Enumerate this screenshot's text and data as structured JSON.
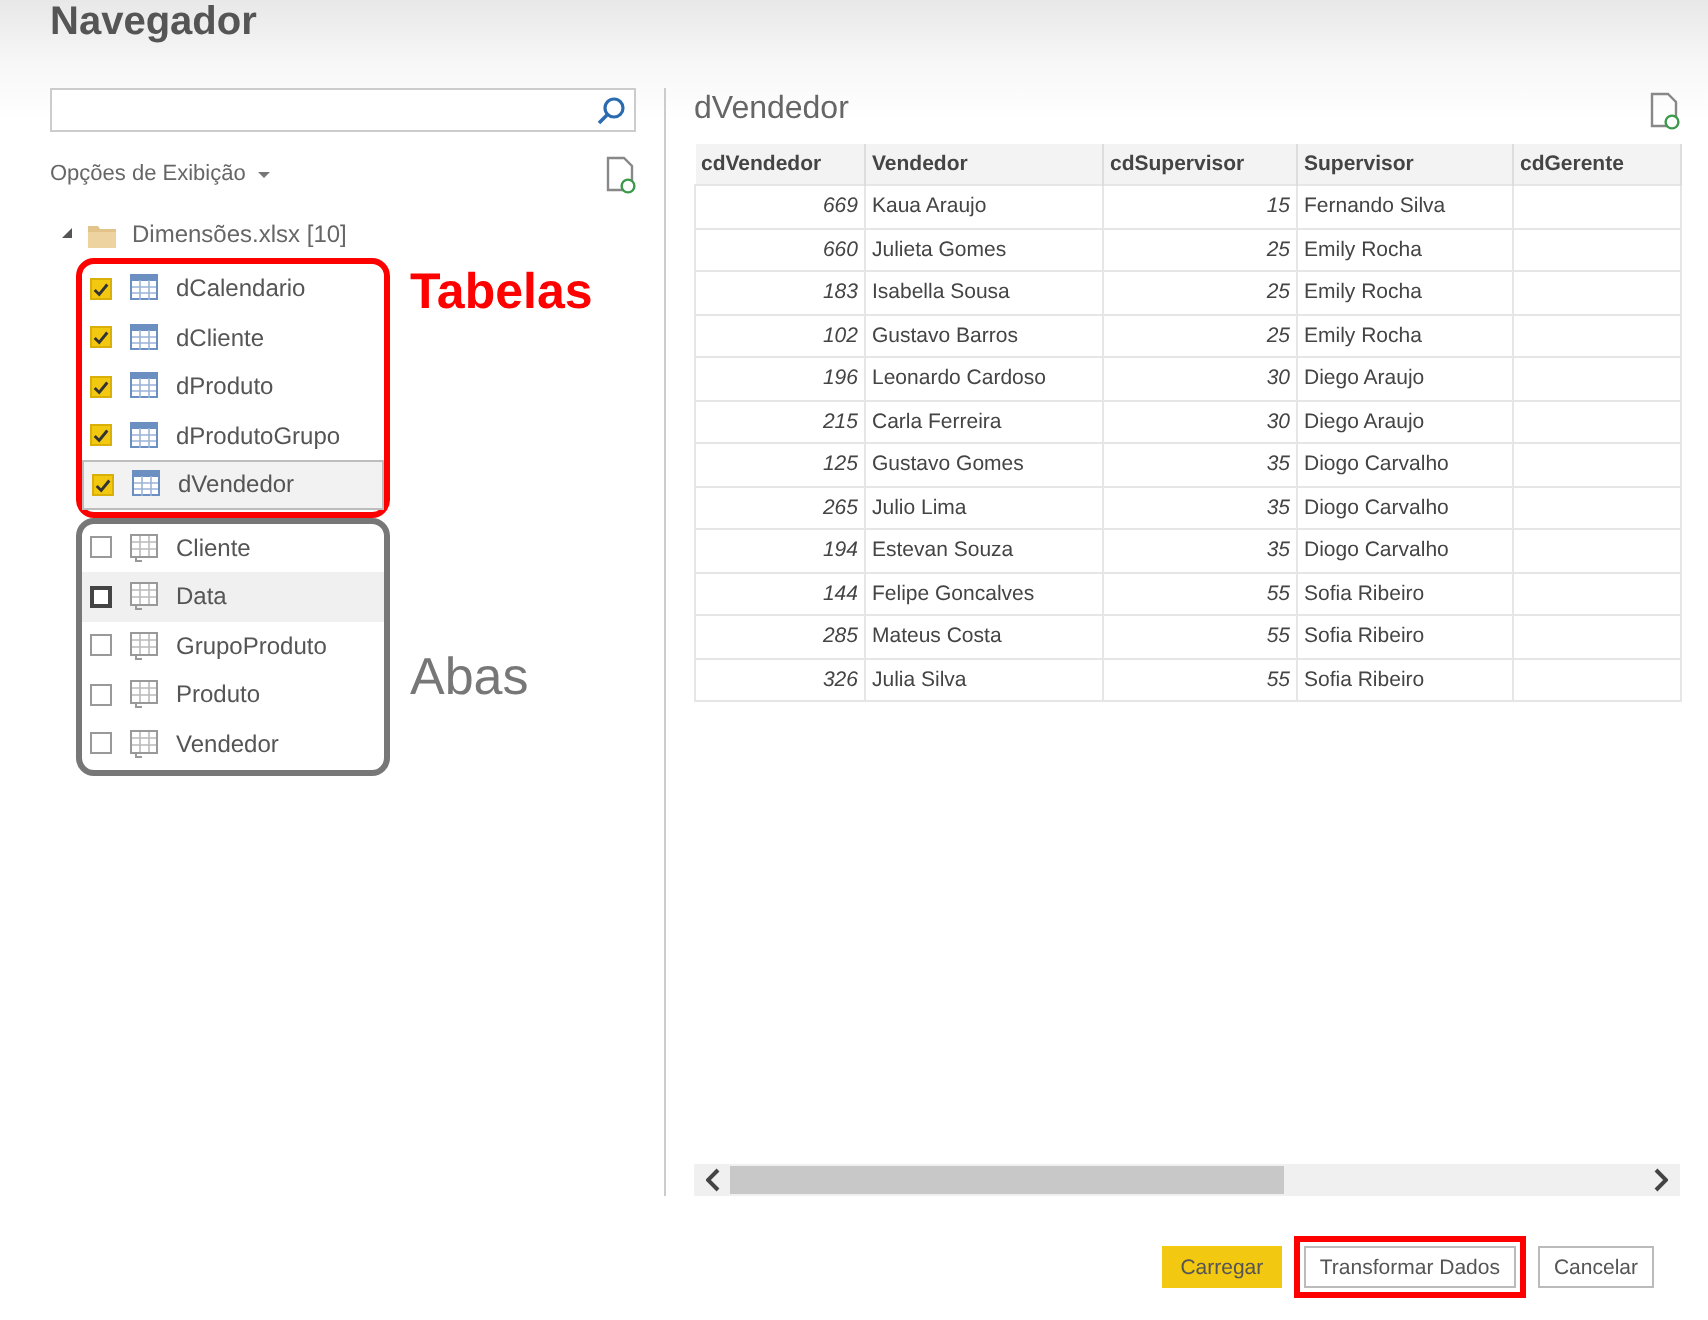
{
  "window": {
    "title": "Navegador"
  },
  "navigator": {
    "view_options": "Opções de Exibição",
    "tree": {
      "label": "Dimensões.xlsx [10]",
      "expanded": true,
      "children": [
        {
          "label": "dCalendario",
          "kind": "table",
          "checked": true,
          "selected": false,
          "hovered": false
        },
        {
          "label": "dCliente",
          "kind": "table",
          "checked": true,
          "selected": false,
          "hovered": false
        },
        {
          "label": "dProduto",
          "kind": "table",
          "checked": true,
          "selected": false,
          "hovered": false
        },
        {
          "label": "dProdutoGrupo",
          "kind": "table",
          "checked": true,
          "selected": false,
          "hovered": false
        },
        {
          "label": "dVendedor",
          "kind": "table",
          "checked": true,
          "selected": true,
          "hovered": false
        },
        {
          "label": "Cliente",
          "kind": "sheet",
          "checked": false,
          "selected": false,
          "hovered": false
        },
        {
          "label": "Data",
          "kind": "sheet",
          "checked": false,
          "selected": false,
          "hovered": true
        },
        {
          "label": "GrupoProduto",
          "kind": "sheet",
          "checked": false,
          "selected": false,
          "hovered": false
        },
        {
          "label": "Produto",
          "kind": "sheet",
          "checked": false,
          "selected": false,
          "hovered": false
        },
        {
          "label": "Vendedor",
          "kind": "sheet",
          "checked": false,
          "selected": false,
          "hovered": false
        }
      ]
    },
    "annotations": [
      {
        "label": "Tabelas",
        "color": "#ff0000"
      },
      {
        "label": "Abas",
        "color": "#777777"
      }
    ]
  },
  "preview": {
    "title": "dVendedor",
    "table": {
      "columns": [
        {
          "label": "cdVendedor",
          "kind": "number"
        },
        {
          "label": "Vendedor",
          "kind": "text"
        },
        {
          "label": "cdSupervisor",
          "kind": "number"
        },
        {
          "label": "Supervisor",
          "kind": "text"
        },
        {
          "label": "cdGerente"
        }
      ],
      "rows": [
        [
          "669",
          "Kaua Araujo",
          "15",
          "Fernando Silva"
        ],
        [
          "660",
          "Julieta Gomes",
          "25",
          "Emily Rocha"
        ],
        [
          "183",
          "Isabella Sousa",
          "25",
          "Emily Rocha"
        ],
        [
          "102",
          "Gustavo Barros",
          "25",
          "Emily Rocha"
        ],
        [
          "196",
          "Leonardo Cardoso",
          "30",
          "Diego Araujo"
        ],
        [
          "215",
          "Carla Ferreira",
          "30",
          "Diego Araujo"
        ],
        [
          "125",
          "Gustavo Gomes",
          "35",
          "Diogo Carvalho"
        ],
        [
          "265",
          "Julio Lima",
          "35",
          "Diogo Carvalho"
        ],
        [
          "194",
          "Estevan Souza",
          "35",
          "Diogo Carvalho"
        ],
        [
          "144",
          "Felipe Goncalves",
          "55",
          "Sofia Ribeiro"
        ],
        [
          "285",
          "Mateus Costa",
          "55",
          "Sofia Ribeiro"
        ],
        [
          "326",
          "Julia Silva",
          "55",
          "Sofia Ribeiro"
        ]
      ]
    }
  },
  "buttons": [
    {
      "label": "Carregar",
      "kind": "primary",
      "highlighted": false
    },
    {
      "label": "Transformar Dados",
      "kind": "secondary",
      "highlighted": true
    },
    {
      "label": "Cancelar",
      "kind": "secondary",
      "highlighted": false
    }
  ]
}
